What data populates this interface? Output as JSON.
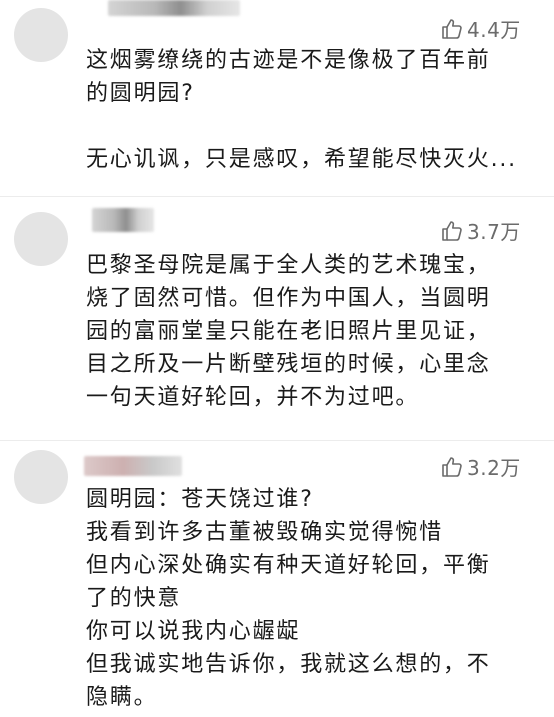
{
  "comments": [
    {
      "likes": "4.4万",
      "lines": [
        "这烟雾缭绕的古迹是不是像极了百年前",
        "的圆明园?",
        "",
        "无心讥讽，只是感叹，希望能尽快灭火..."
      ]
    },
    {
      "likes": "3.7万",
      "lines": [
        "巴黎圣母院是属于全人类的艺术瑰宝，",
        "烧了固然可惜。但作为中国人，当圆明",
        "园的富丽堂皇只能在老旧照片里见证，",
        "目之所及一片断壁残垣的时候，心里念",
        "一句天道好轮回，并不为过吧。"
      ]
    },
    {
      "likes": "3.2万",
      "lines": [
        "圆明园：苍天饶过谁?",
        "我看到许多古董被毁确实觉得惋惜",
        "但内心深处确实有种天道好轮回，平衡",
        "了的快意",
        "你可以说我内心龌龊",
        "但我诚实地告诉你，我就这么想的，不",
        "隐瞒。"
      ]
    }
  ],
  "icons": {
    "like": "thumbs-up-icon"
  },
  "colors": {
    "text": "#1a1a1a",
    "likes": "#6b6b6b",
    "avatar": "#e4e4e4"
  }
}
